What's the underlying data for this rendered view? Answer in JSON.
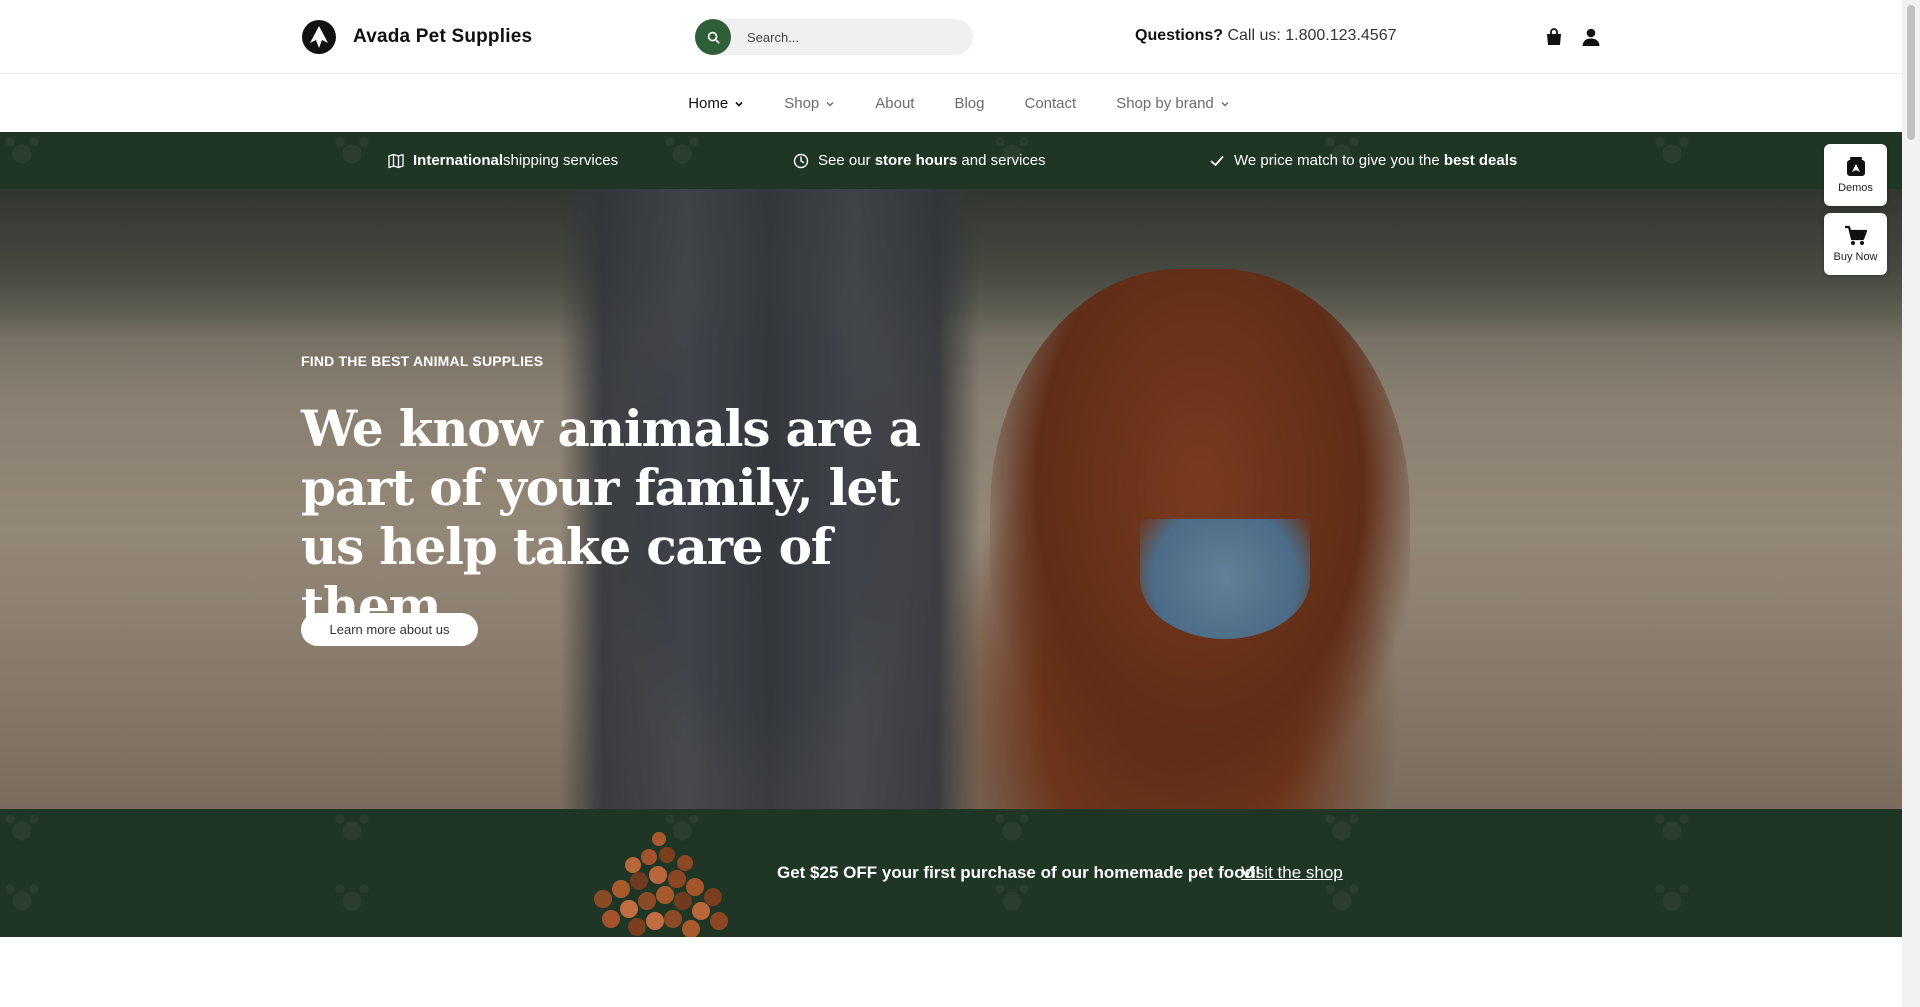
{
  "brand": {
    "name": "Avada Pet Supplies",
    "logo_icon": "paw-logo-icon"
  },
  "search": {
    "placeholder": "Search...",
    "icon": "search-icon"
  },
  "contact": {
    "prefix": "Questions?",
    "text": "Call us: 1.800.123.4567"
  },
  "header_icons": [
    "shopping-bag-icon",
    "user-icon"
  ],
  "nav": {
    "items": [
      {
        "label": "Home",
        "has_dropdown": true,
        "active": true
      },
      {
        "label": "Shop",
        "has_dropdown": true
      },
      {
        "label": "About"
      },
      {
        "label": "Blog"
      },
      {
        "label": "Contact"
      },
      {
        "label": "Shop by brand",
        "has_dropdown": true
      }
    ]
  },
  "features": {
    "shipping": {
      "strong": "International",
      "rest": " shipping services",
      "icon": "map-icon"
    },
    "hours": {
      "pre": "See our ",
      "strong": "store hours",
      "post": " and services",
      "icon": "clock-icon"
    },
    "price": {
      "pre": "We price match to give you the ",
      "strong": "best deals",
      "icon": "check-icon"
    }
  },
  "hero": {
    "eyebrow": "FIND THE BEST ANIMAL SUPPLIES",
    "headline": "We know animals are a part of your family, let us help take care of them",
    "button": "Learn more about us"
  },
  "promo": {
    "text": "Get $25 OFF your first purchase of our homemade pet food!",
    "link": "Visit the shop"
  },
  "side_widgets": {
    "demos": "Demos",
    "buy_now": "Buy Now"
  },
  "colors": {
    "brand_green": "#2f5f39",
    "dark_green_strip": "#1f3525",
    "white": "#ffffff"
  }
}
